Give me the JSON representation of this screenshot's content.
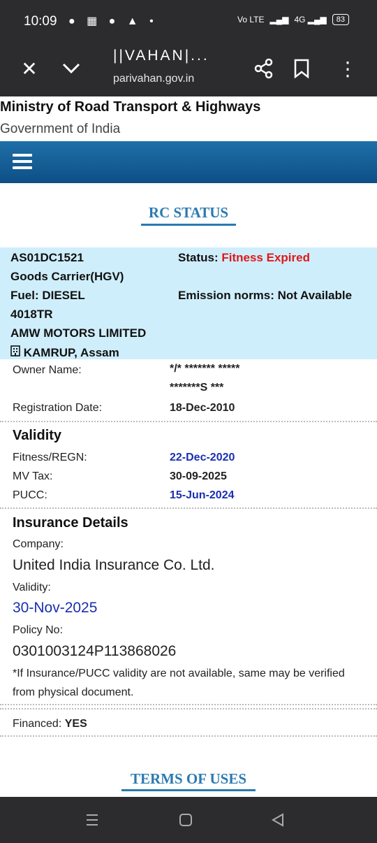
{
  "status_bar": {
    "time": "10:09",
    "left_icons": "● ▦ ● ▲ •",
    "network": "Vo LTE",
    "signal": "▂▄▆",
    "data_signal": "4G ▂▄▆",
    "battery": "83"
  },
  "browser": {
    "title": "||VAHAN|...",
    "url": "parivahan.gov.in",
    "close_icon": "✕",
    "down_icon": "⌄",
    "share_icon": "share-icon",
    "bookmark_icon": "bookmark-icon",
    "more_icon": "⋮"
  },
  "header": {
    "ministry": "Ministry of Road Transport & Highways",
    "govt": "Government of India"
  },
  "rc_status_title": "RC STATUS",
  "vehicle": {
    "reg_no": "AS01DC1521",
    "class": "Goods Carrier(HGV)",
    "fuel": "Fuel: DIESEL",
    "model": "4018TR",
    "maker": "AMW MOTORS LIMITED",
    "rto_icon": "🏢",
    "rto": "KAMRUP, Assam",
    "status_label": "Status:",
    "status_value": "Fitness Expired",
    "emission": "Emission norms: Not Available"
  },
  "owner": {
    "label": "Owner Name:",
    "line1": "*/* ******* *****",
    "line2": "*******S ***"
  },
  "registration": {
    "label": "Registration Date:",
    "value": "18-Dec-2010"
  },
  "validity": {
    "heading": "Validity",
    "rows": [
      {
        "label": "Fitness/REGN:",
        "value": "22-Dec-2020"
      },
      {
        "label": "MV Tax:",
        "value": "30-09-2025"
      },
      {
        "label": "PUCC:",
        "value": "15-Jun-2024"
      }
    ]
  },
  "insurance": {
    "heading": "Insurance Details",
    "company_label": "Company:",
    "company": "United India Insurance Co. Ltd.",
    "validity_label": "Validity:",
    "validity": "30-Nov-2025",
    "policy_label": "Policy No:",
    "policy": "0301003124P113868026",
    "note": "*If Insurance/PUCC validity are not available, same may be verified from physical document."
  },
  "financed": {
    "label": "Financed:",
    "value": "YES"
  },
  "terms": "TERMS OF USES",
  "nav": {
    "recent_icon": "|||",
    "home_icon": "▢",
    "back_icon": "◁"
  }
}
